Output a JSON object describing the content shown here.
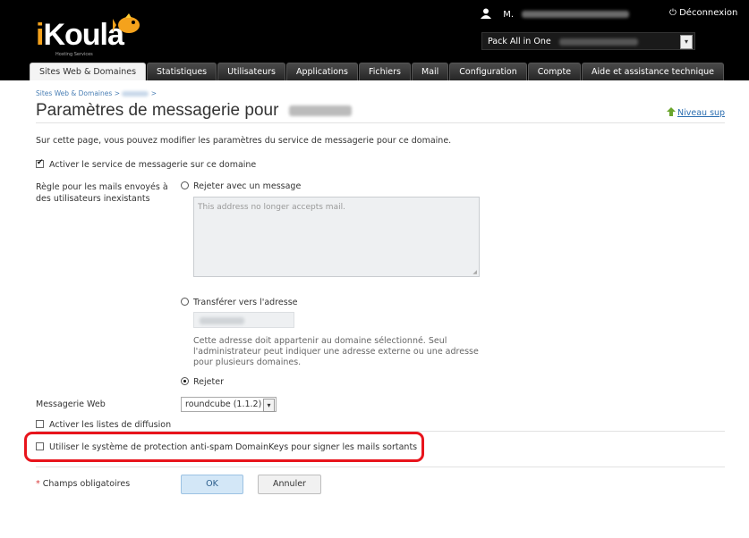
{
  "header": {
    "logo_text_a": "i",
    "logo_text_b": "Koula",
    "logo_tagline": "Hosting Services",
    "user_prefix": "M.",
    "logout_label": "Déconnexion",
    "pack_label": "Pack All in One"
  },
  "tabs": [
    {
      "label": "Sites Web & Domaines",
      "active": true
    },
    {
      "label": "Statistiques"
    },
    {
      "label": "Utilisateurs"
    },
    {
      "label": "Applications"
    },
    {
      "label": "Fichiers"
    },
    {
      "label": "Mail"
    },
    {
      "label": "Configuration"
    },
    {
      "label": "Compte"
    },
    {
      "label": "Aide et assistance technique"
    }
  ],
  "breadcrumb": {
    "root": "Sites Web & Domaines",
    "sep": ">"
  },
  "page": {
    "title": "Paramètres de messagerie pour",
    "up_label": "Niveau sup",
    "intro": "Sur cette page, vous pouvez modifier les paramètres du service de messagerie pour ce domaine.",
    "enable_mail_label": "Activer le service de messagerie sur ce domaine",
    "rule_label_1": "Règle pour les mails envoyés à",
    "rule_label_2": "des utilisateurs inexistants",
    "option_reject_msg": "Rejeter avec un message",
    "reject_msg_value": "This address no longer accepts mail.",
    "option_forward": "Transférer vers l'adresse",
    "forward_note_1": "Cette adresse doit appartenir au domaine sélectionné. Seul",
    "forward_note_2": "l'administrateur peut indiquer une adresse externe ou une adresse",
    "forward_note_3": "pour plusieurs domaines.",
    "option_reject": "Rejeter",
    "webmail_label": "Messagerie Web",
    "webmail_value": "roundcube (1.1.2)",
    "mailing_lists_label": "Activer les listes de diffusion",
    "domainkeys_label": "Utiliser le système de protection anti-spam DomainKeys pour signer les mails sortants",
    "required_star": "*",
    "required_label": "Champs obligatoires",
    "ok_label": "OK",
    "cancel_label": "Annuler"
  },
  "colors": {
    "header_bg": "#000000",
    "accent_orange": "#f4a21c",
    "link_blue": "#2a6db0",
    "highlight_red": "#e8141c",
    "ok_bg": "#d3e7f7"
  }
}
